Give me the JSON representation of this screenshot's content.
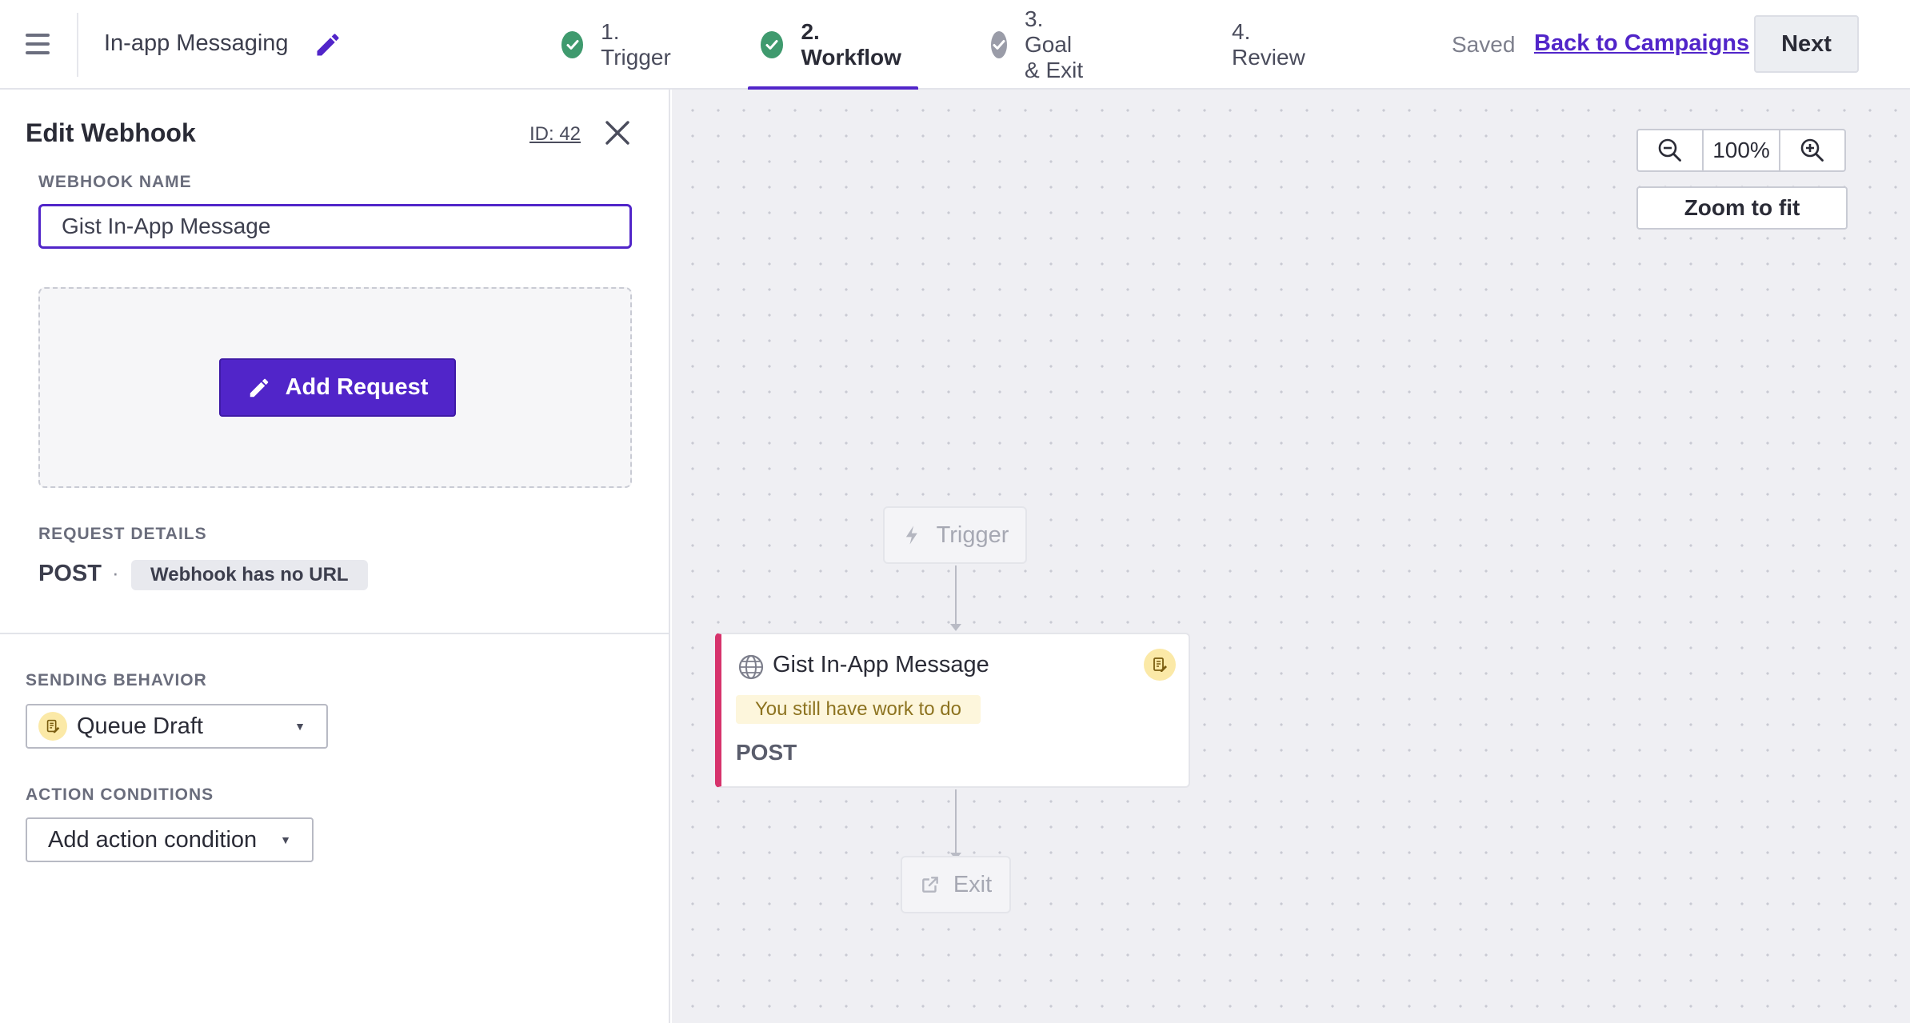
{
  "header": {
    "campaign_name": "In-app Messaging",
    "steps": [
      {
        "label": "1. Trigger",
        "status": "complete"
      },
      {
        "label": "2. Workflow",
        "status": "complete-active"
      },
      {
        "label": "3. Goal & Exit",
        "status": "partial"
      },
      {
        "label": "4. Review",
        "status": "none"
      }
    ],
    "saved_label": "Saved",
    "back_link": "Back to Campaigns",
    "next_label": "Next"
  },
  "panel": {
    "title": "Edit Webhook",
    "id_label": "ID: 42",
    "webhook_name_label": "WEBHOOK NAME",
    "webhook_name_value": "Gist In-App Message",
    "add_request_label": "Add Request",
    "request_details_label": "REQUEST DETAILS",
    "method": "POST",
    "separator": "·",
    "url_status": "Webhook has no URL",
    "sending_behavior_label": "SENDING BEHAVIOR",
    "sending_behavior_value": "Queue Draft",
    "action_conditions_label": "ACTION CONDITIONS",
    "action_condition_placeholder": "Add action condition"
  },
  "canvas": {
    "zoom_level": "100%",
    "zoom_fit_label": "Zoom to fit",
    "trigger_node_label": "Trigger",
    "webhook_node": {
      "title": "Gist In-App Message",
      "warning": "You still have work to do",
      "method": "POST"
    },
    "exit_node_label": "Exit"
  },
  "colors": {
    "accent": "#5125c9",
    "success": "#3f9a6e",
    "node_stripe": "#d6336c",
    "warning_bg": "#fdf6dc",
    "draft_icon_bg": "#fbe9a7"
  },
  "icons": [
    "menu-icon",
    "pencil-icon",
    "check-icon",
    "close-icon",
    "zoom-out-icon",
    "zoom-in-icon",
    "lightning-icon",
    "globe-icon",
    "draft-icon",
    "exit-icon",
    "caret-down-icon"
  ]
}
